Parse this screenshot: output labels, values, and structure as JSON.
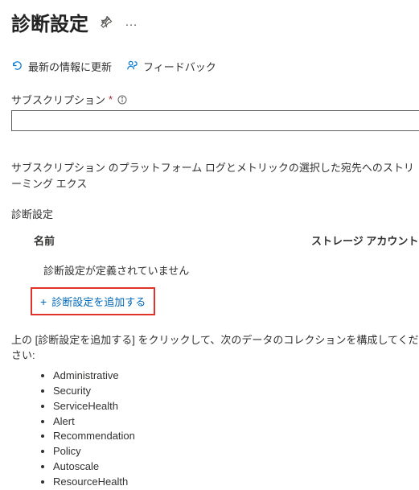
{
  "header": {
    "title": "診断設定"
  },
  "toolbar": {
    "refresh": "最新の情報に更新",
    "feedback": "フィードバック"
  },
  "subscription": {
    "label": "サブスクリプション",
    "required": "*"
  },
  "description": "サブスクリプション のプラットフォーム ログとメトリックの選択した宛先へのストリーミング エクス",
  "section": {
    "label": "診断設定"
  },
  "table": {
    "col_name": "名前",
    "col_storage": "ストレージ アカウント",
    "empty": "診断設定が定義されていません"
  },
  "add": {
    "plus": "+",
    "label": "診断設定を追加する"
  },
  "instruction": "上の [診断設定を追加する] をクリックして、次のデータのコレクションを構成してください:",
  "categories": [
    "Administrative",
    "Security",
    "ServiceHealth",
    "Alert",
    "Recommendation",
    "Policy",
    "Autoscale",
    "ResourceHealth"
  ]
}
